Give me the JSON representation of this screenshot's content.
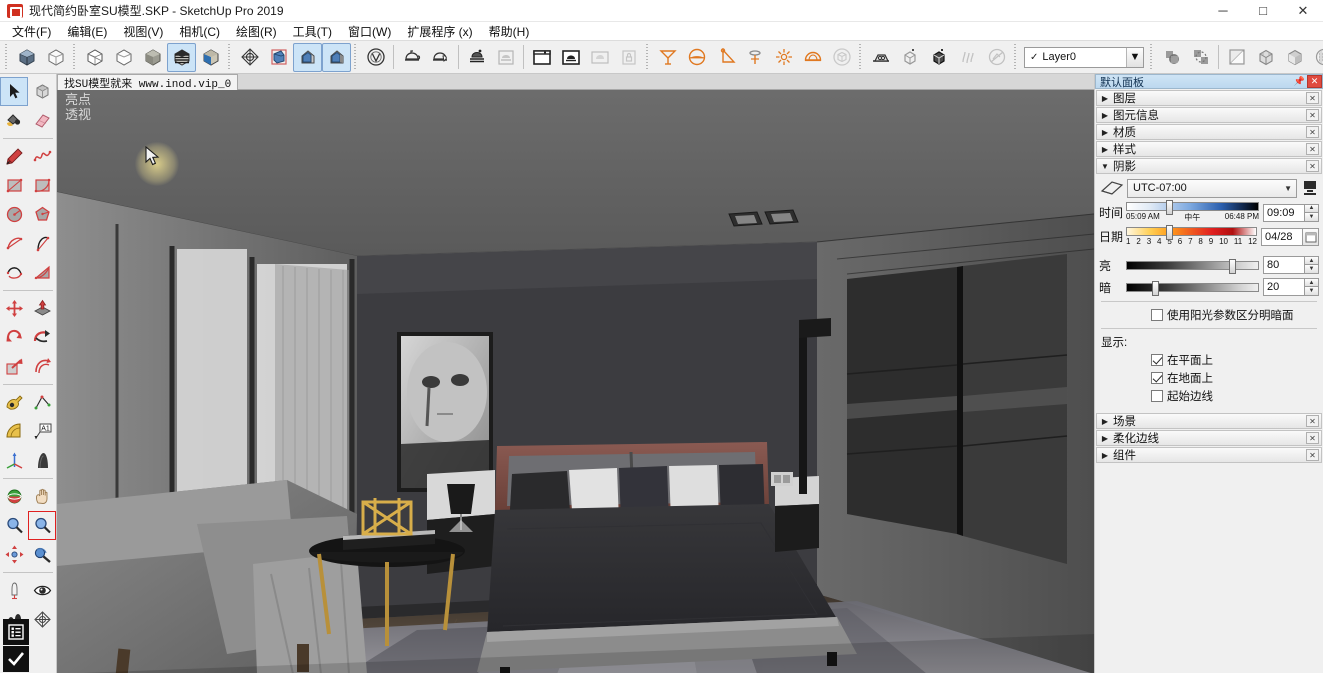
{
  "titlebar": {
    "title": "现代简约卧室SU模型.SKP - SketchUp Pro 2019",
    "app_icon": "sketchup-icon",
    "minimize": "─",
    "maximize": "□",
    "close": "✕"
  },
  "menubar": {
    "items": [
      {
        "label": "文件(F)",
        "name": "menu-file"
      },
      {
        "label": "编辑(E)",
        "name": "menu-edit"
      },
      {
        "label": "视图(V)",
        "name": "menu-view"
      },
      {
        "label": "相机(C)",
        "name": "menu-camera"
      },
      {
        "label": "绘图(R)",
        "name": "menu-draw"
      },
      {
        "label": "工具(T)",
        "name": "menu-tools"
      },
      {
        "label": "窗口(W)",
        "name": "menu-window"
      },
      {
        "label": "扩展程序 (x)",
        "name": "menu-extensions"
      },
      {
        "label": "帮助(H)",
        "name": "menu-help"
      }
    ]
  },
  "toolbar": {
    "layer": {
      "value": "Layer0",
      "check": "✓",
      "arrow": "▼"
    },
    "groups": [
      {
        "name": "styles-toolbar",
        "buttons": [
          {
            "icon": "style-shaded-icon",
            "active": false
          },
          {
            "icon": "style-wireframe-icon",
            "active": false
          }
        ]
      },
      {
        "name": "face-styles-toolbar",
        "buttons": [
          {
            "icon": "hidden-line-icon",
            "active": false
          },
          {
            "icon": "wireframe-box-icon",
            "active": false
          },
          {
            "icon": "shaded-box-icon",
            "active": false
          },
          {
            "icon": "shaded-texture-icon",
            "active": true
          },
          {
            "icon": "monochrome-icon",
            "active": false
          }
        ]
      },
      {
        "name": "section-toolbar",
        "buttons": [
          {
            "icon": "section-plane-icon",
            "active": false
          },
          {
            "icon": "section-cut-icon",
            "active": false
          },
          {
            "icon": "display-section-planes-icon",
            "active": true
          },
          {
            "icon": "display-section-cuts-icon",
            "active": true
          }
        ]
      },
      {
        "name": "vray-main-toolbar",
        "buttons": [
          {
            "icon": "vray-asset-editor-icon",
            "active": false
          },
          {
            "icon": "vray-render-icon",
            "active": false
          },
          {
            "icon": "vray-render-interactive-icon",
            "active": false
          },
          {
            "icon": "vray-render-cloud-icon",
            "active": false
          },
          {
            "icon": "vray-batch-render-icon",
            "active": false
          },
          {
            "icon": "vray-frame-buffer-icon",
            "active": false
          },
          {
            "icon": "vray-render-view-icon",
            "active": false
          },
          {
            "icon": "vray-cloud-icon",
            "active": false
          },
          {
            "icon": "vray-lock-icon",
            "active": false
          }
        ]
      },
      {
        "name": "vray-lights-toolbar",
        "buttons": [
          {
            "icon": "vray-rectangle-light-icon",
            "active": false
          },
          {
            "icon": "vray-sphere-light-icon",
            "active": false
          },
          {
            "icon": "vray-spot-light-icon",
            "active": false
          },
          {
            "icon": "vray-ies-light-icon",
            "active": false
          },
          {
            "icon": "vray-omni-light-icon",
            "active": false
          },
          {
            "icon": "vray-dome-light-icon",
            "active": false
          },
          {
            "icon": "vray-mesh-light-icon",
            "active": false
          }
        ]
      },
      {
        "name": "vray-objects-toolbar",
        "buttons": [
          {
            "icon": "vray-infinite-plane-icon",
            "active": false
          },
          {
            "icon": "vray-proxy-mesh-icon",
            "active": false
          },
          {
            "icon": "vray-fur-icon",
            "active": false
          },
          {
            "icon": "vray-clipper-icon",
            "active": false
          },
          {
            "icon": "vray-scene-icon",
            "active": false
          },
          {
            "icon": "vray-decal-icon",
            "active": false
          }
        ]
      },
      {
        "name": "vray-utilities-toolbar",
        "buttons": [
          {
            "icon": "vray-material-override-icon",
            "active": false
          },
          {
            "icon": "vray-uv-icon",
            "active": false
          }
        ]
      },
      {
        "name": "style-preview-toolbar",
        "buttons": [
          {
            "icon": "xray-icon",
            "active": false
          },
          {
            "icon": "back-edges-icon",
            "active": false
          },
          {
            "icon": "wireframe-view-icon",
            "active": false
          },
          {
            "icon": "hidden-line-view-icon",
            "active": false
          },
          {
            "icon": "shaded-view-icon",
            "active": false
          },
          {
            "icon": "texture-view-icon",
            "active": false
          },
          {
            "icon": "monochrome-view-icon",
            "active": false
          }
        ]
      }
    ]
  },
  "lefttoolbar": {
    "groups": [
      {
        "name": "principal",
        "buttons": [
          {
            "icon": "select-arrow-icon",
            "active": true
          },
          {
            "icon": "make-component-icon",
            "active": false
          },
          {
            "icon": "paint-bucket-icon",
            "active": false
          },
          {
            "icon": "eraser-icon",
            "active": false
          }
        ]
      },
      {
        "name": "drawing",
        "buttons": [
          {
            "icon": "line-pencil-icon",
            "active": false
          },
          {
            "icon": "freehand-icon",
            "active": false
          },
          {
            "icon": "rectangle-icon",
            "active": false
          },
          {
            "icon": "rotated-rectangle-icon",
            "active": false
          },
          {
            "icon": "circle-icon",
            "active": false
          },
          {
            "icon": "polygon-icon",
            "active": false
          },
          {
            "icon": "arc-icon",
            "active": false
          },
          {
            "icon": "two-point-arc-icon",
            "active": false
          },
          {
            "icon": "three-point-arc-icon",
            "active": false
          },
          {
            "icon": "pie-icon",
            "active": false
          }
        ]
      },
      {
        "name": "modification",
        "buttons": [
          {
            "icon": "move-icon",
            "active": false
          },
          {
            "icon": "push-pull-icon",
            "active": false
          },
          {
            "icon": "rotate-icon",
            "active": false
          },
          {
            "icon": "follow-me-icon",
            "active": false
          },
          {
            "icon": "scale-icon",
            "active": false
          },
          {
            "icon": "offset-icon",
            "active": false
          }
        ]
      },
      {
        "name": "construction",
        "buttons": [
          {
            "icon": "tape-measure-icon",
            "active": false
          },
          {
            "icon": "dimension-icon",
            "active": false
          },
          {
            "icon": "protractor-icon",
            "active": false
          },
          {
            "icon": "text-label-icon",
            "active": false
          },
          {
            "icon": "axes-icon",
            "active": false
          },
          {
            "icon": "three-d-text-icon",
            "active": false
          }
        ]
      },
      {
        "name": "camera",
        "buttons": [
          {
            "icon": "orbit-icon",
            "active": false
          },
          {
            "icon": "pan-hand-icon",
            "active": false
          },
          {
            "icon": "zoom-icon",
            "active": false
          },
          {
            "icon": "zoom-window-icon",
            "active": true
          },
          {
            "icon": "zoom-extents-icon",
            "active": false
          },
          {
            "icon": "previous-view-icon",
            "active": false
          }
        ]
      },
      {
        "name": "walkthrough",
        "buttons": [
          {
            "icon": "position-camera-icon",
            "active": false
          },
          {
            "icon": "look-around-icon",
            "active": false
          },
          {
            "icon": "walk-icon",
            "active": false
          },
          {
            "icon": "section-plane-tool-icon",
            "active": false
          }
        ]
      }
    ],
    "bottom": [
      {
        "icon": "outliner-icon"
      },
      {
        "icon": "checkmark-icon"
      }
    ]
  },
  "viewport": {
    "scene_tab": "找SU模型就来 www.inod.vip_0",
    "overlay_line1": "亮点",
    "overlay_line2": "透视",
    "scene_description": "现代简约卧室室内透视视图",
    "cursor": "arrow-cursor"
  },
  "rightpanel": {
    "title": "默认面板",
    "pin_icon": "pin-icon",
    "close_icon": "close-icon",
    "collapsed_top": [
      {
        "label": "图层",
        "name": "panel-layers",
        "expanded": false
      },
      {
        "label": "图元信息",
        "name": "panel-entity-info",
        "expanded": false
      },
      {
        "label": "材质",
        "name": "panel-materials",
        "expanded": false
      },
      {
        "label": "样式",
        "name": "panel-styles",
        "expanded": false
      }
    ],
    "shadows": {
      "header": "阴影",
      "expanded": true,
      "toggle_icon": "shadow-toggle-icon",
      "timezone": "UTC-07:00",
      "display_light_icon": "display-shadows-icon",
      "time": {
        "label": "时间",
        "min_label": "05:09 AM",
        "noon_label": "中午",
        "max_label": "06:48 PM",
        "value": "09:09",
        "knob_percent": 32
      },
      "date": {
        "label": "日期",
        "months": [
          "1",
          "2",
          "3",
          "4",
          "5",
          "6",
          "7",
          "8",
          "9",
          "10",
          "11",
          "12"
        ],
        "value": "04/28",
        "knob_percent": 32,
        "calendar_icon": "calendar-icon"
      },
      "light": {
        "label": "亮",
        "value": "80",
        "knob_percent": 79
      },
      "dark": {
        "label": "暗",
        "value": "20",
        "knob_percent": 20
      },
      "use_sun_checkbox": {
        "label": "使用阳光参数区分明暗面",
        "checked": false
      },
      "display_label": "显示:",
      "display_options": [
        {
          "label": "在平面上",
          "checked": true
        },
        {
          "label": "在地面上",
          "checked": true
        },
        {
          "label": "起始边线",
          "checked": false
        }
      ]
    },
    "collapsed_bottom": [
      {
        "label": "场景",
        "name": "panel-scenes",
        "expanded": false
      },
      {
        "label": "柔化边线",
        "name": "panel-soften-edges",
        "expanded": false
      },
      {
        "label": "组件",
        "name": "panel-components",
        "expanded": false
      }
    ]
  }
}
